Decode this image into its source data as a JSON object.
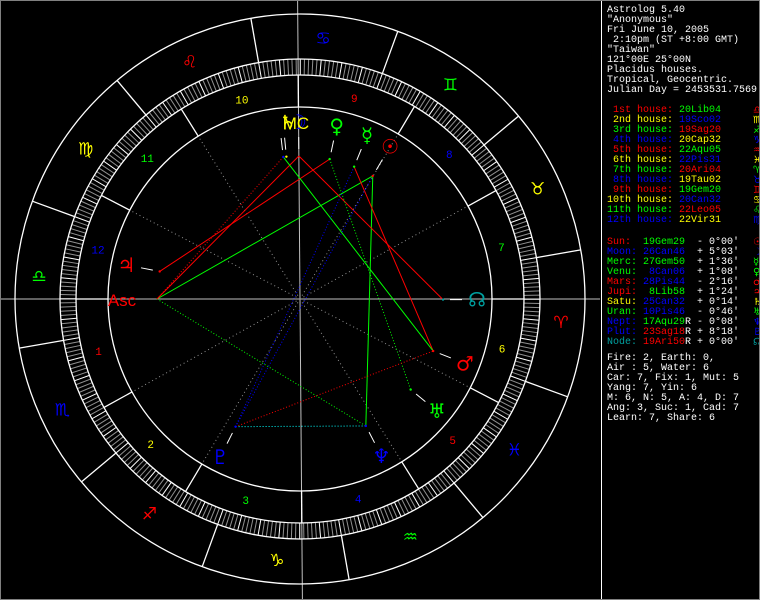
{
  "info": [
    "Astrolog 5.40",
    "\"Anonymous\"",
    "Fri June 10, 2005",
    " 2:10pm (ST +8:00 GMT)",
    "\"Taiwan\"",
    "121°00E 25°00N",
    "Placidus houses.",
    "Tropical, Geocentric.",
    "Julian Day = 2453531.7569"
  ],
  "colors": {
    "red": "#ff0000",
    "green": "#00ff00",
    "blue": "#0000ff",
    "yellow": "#ffff00",
    "teal": "#00a0a0",
    "white": "#ffffff",
    "gray": "#a0a0a0",
    "cyan": "#00ffff"
  },
  "houses": [
    {
      "label": "1st house:",
      "value": "20Lib04",
      "lon": 200.07,
      "color": "red",
      "vcolor": "green",
      "glyph": "♎",
      "num": "1"
    },
    {
      "label": "2nd house:",
      "value": "19Sco02",
      "lon": 229.03,
      "color": "yellow",
      "vcolor": "blue",
      "glyph": "♏",
      "num": "2"
    },
    {
      "label": "3rd house:",
      "value": "19Sag20",
      "lon": 259.33,
      "color": "green",
      "vcolor": "red",
      "glyph": "♐",
      "num": "3"
    },
    {
      "label": "4th house:",
      "value": "20Cap32",
      "lon": 290.53,
      "color": "blue",
      "vcolor": "yellow",
      "glyph": "♑",
      "num": "4"
    },
    {
      "label": "5th house:",
      "value": "22Aqu05",
      "lon": 322.08,
      "color": "red",
      "vcolor": "green",
      "glyph": "♒",
      "num": "5"
    },
    {
      "label": "6th house:",
      "value": "22Pis31",
      "lon": 352.52,
      "color": "yellow",
      "vcolor": "blue",
      "glyph": "♓",
      "num": "6"
    },
    {
      "label": "7th house:",
      "value": "20Ari04",
      "lon": 20.07,
      "color": "green",
      "vcolor": "red",
      "glyph": "♈",
      "num": "7"
    },
    {
      "label": "8th house:",
      "value": "19Tau02",
      "lon": 49.03,
      "color": "blue",
      "vcolor": "yellow",
      "glyph": "♉",
      "num": "8"
    },
    {
      "label": "9th house:",
      "value": "19Gem20",
      "lon": 79.33,
      "color": "red",
      "vcolor": "green",
      "glyph": "♊",
      "num": "9"
    },
    {
      "label": "10th house:",
      "value": "20Can32",
      "lon": 110.53,
      "color": "yellow",
      "vcolor": "blue",
      "glyph": "♋",
      "num": "10"
    },
    {
      "label": "11th house:",
      "value": "22Leo05",
      "lon": 142.08,
      "color": "green",
      "vcolor": "red",
      "glyph": "♌",
      "num": "11"
    },
    {
      "label": "12th house:",
      "value": "22Vir31",
      "lon": 172.52,
      "color": "blue",
      "vcolor": "yellow",
      "glyph": "♍",
      "num": "12"
    }
  ],
  "planets": [
    {
      "key": "Sun",
      "label": "Sun:",
      "value": "19Gem29",
      "retro": "",
      "dev": "- 0°00'",
      "lon": 79.48,
      "color": "red",
      "vcolor": "green",
      "glyph": "☉"
    },
    {
      "key": "Moon",
      "label": "Moon:",
      "value": "26Can46",
      "retro": "",
      "dev": "+ 5°03'",
      "lon": 116.77,
      "color": "blue",
      "vcolor": "blue",
      "glyph": "☽"
    },
    {
      "key": "Merc",
      "label": "Merc:",
      "value": "27Gem50",
      "retro": "",
      "dev": "+ 1°36'",
      "lon": 87.83,
      "color": "green",
      "vcolor": "green",
      "glyph": "☿"
    },
    {
      "key": "Venu",
      "label": "Venu:",
      "value": " 8Can06",
      "retro": "",
      "dev": "+ 1°08'",
      "lon": 98.1,
      "color": "green",
      "vcolor": "blue",
      "glyph": "♀"
    },
    {
      "key": "Mars",
      "label": "Mars:",
      "value": "28Pis44",
      "retro": "",
      "dev": "- 2°16'",
      "lon": 358.73,
      "color": "red",
      "vcolor": "blue",
      "glyph": "♂"
    },
    {
      "key": "Jupi",
      "label": "Jupi:",
      "value": " 8Lib58",
      "retro": "",
      "dev": "+ 1°24'",
      "lon": 188.97,
      "color": "red",
      "vcolor": "green",
      "glyph": "♃"
    },
    {
      "key": "Satu",
      "label": "Satu:",
      "value": "25Can32",
      "retro": "",
      "dev": "+ 0°14'",
      "lon": 115.53,
      "color": "yellow",
      "vcolor": "blue",
      "glyph": "♄"
    },
    {
      "key": "Uran",
      "label": "Uran:",
      "value": "10Pis46",
      "retro": "",
      "dev": "- 0°46'",
      "lon": 340.77,
      "color": "green",
      "vcolor": "blue",
      "glyph": "♅"
    },
    {
      "key": "Nept",
      "label": "Nept:",
      "value": "17Aqu29",
      "retro": "R",
      "dev": "- 0°08'",
      "lon": 317.48,
      "color": "blue",
      "vcolor": "green",
      "glyph": "♆"
    },
    {
      "key": "Plut",
      "label": "Plut:",
      "value": "23Sag18",
      "retro": "R",
      "dev": "+ 8°18'",
      "lon": 263.3,
      "color": "blue",
      "vcolor": "red",
      "glyph": "♇"
    },
    {
      "key": "Node",
      "label": "Node:",
      "value": "19Ari50",
      "retro": "R",
      "dev": "+ 0°00'",
      "lon": 19.83,
      "color": "teal",
      "vcolor": "red",
      "glyph": "☊"
    }
  ],
  "angles": {
    "asc_label": "Asc",
    "mc_label": "MC"
  },
  "stats": [
    "Fire: 2, Earth: 0,",
    "Air : 5, Water: 6",
    "Car: 7, Fix: 1, Mut: 5",
    "Yang: 7, Yin: 6",
    "M: 6, N: 5, A: 4, D: 7",
    "Ang: 3, Suc: 1, Cad: 7",
    "Learn: 7, Share: 6"
  ],
  "signs": [
    {
      "glyph": "♈",
      "color": "red"
    },
    {
      "glyph": "♉",
      "color": "yellow"
    },
    {
      "glyph": "♊",
      "color": "green"
    },
    {
      "glyph": "♋",
      "color": "blue"
    },
    {
      "glyph": "♌",
      "color": "red"
    },
    {
      "glyph": "♍",
      "color": "yellow"
    },
    {
      "glyph": "♎",
      "color": "green"
    },
    {
      "glyph": "♏",
      "color": "blue"
    },
    {
      "glyph": "♐",
      "color": "red"
    },
    {
      "glyph": "♑",
      "color": "yellow"
    },
    {
      "glyph": "♒",
      "color": "green"
    },
    {
      "glyph": "♓",
      "color": "blue"
    }
  ],
  "aspects": [
    {
      "a": "Asc",
      "b": "Sun",
      "type": "trine",
      "color": "green",
      "dotted": false
    },
    {
      "a": "Sun",
      "b": "Nept",
      "type": "trine",
      "color": "green",
      "dotted": false
    },
    {
      "a": "Asc",
      "b": "Nept",
      "type": "trine",
      "color": "green",
      "dotted": true
    },
    {
      "a": "Asc",
      "b": "MC",
      "type": "square",
      "color": "red",
      "dotted": false
    },
    {
      "a": "Asc",
      "b": "Moon",
      "type": "square",
      "color": "red",
      "dotted": true
    },
    {
      "a": "Jupi",
      "b": "Venu",
      "type": "square",
      "color": "red",
      "dotted": false
    },
    {
      "a": "MC",
      "b": "Node",
      "type": "square",
      "color": "red",
      "dotted": false
    },
    {
      "a": "Merc",
      "b": "Mars",
      "type": "square",
      "color": "red",
      "dotted": false
    },
    {
      "a": "Moon",
      "b": "Mars",
      "type": "trine",
      "color": "green",
      "dotted": false
    },
    {
      "a": "Venu",
      "b": "Uran",
      "type": "trine",
      "color": "green",
      "dotted": true
    },
    {
      "a": "Merc",
      "b": "Plut",
      "type": "opposition",
      "color": "blue",
      "dotted": true
    },
    {
      "a": "Sun",
      "b": "Plut",
      "type": "opposition",
      "color": "blue",
      "dotted": true
    },
    {
      "a": "Plut",
      "b": "Mars",
      "type": "square",
      "color": "red",
      "dotted": true
    },
    {
      "a": "Plut",
      "b": "Nept",
      "type": "sextile",
      "color": "cyan",
      "dotted": true
    },
    {
      "a": "Moon",
      "b": "Satu",
      "type": "conjunction",
      "color": "yellow",
      "dotted": true
    }
  ]
}
